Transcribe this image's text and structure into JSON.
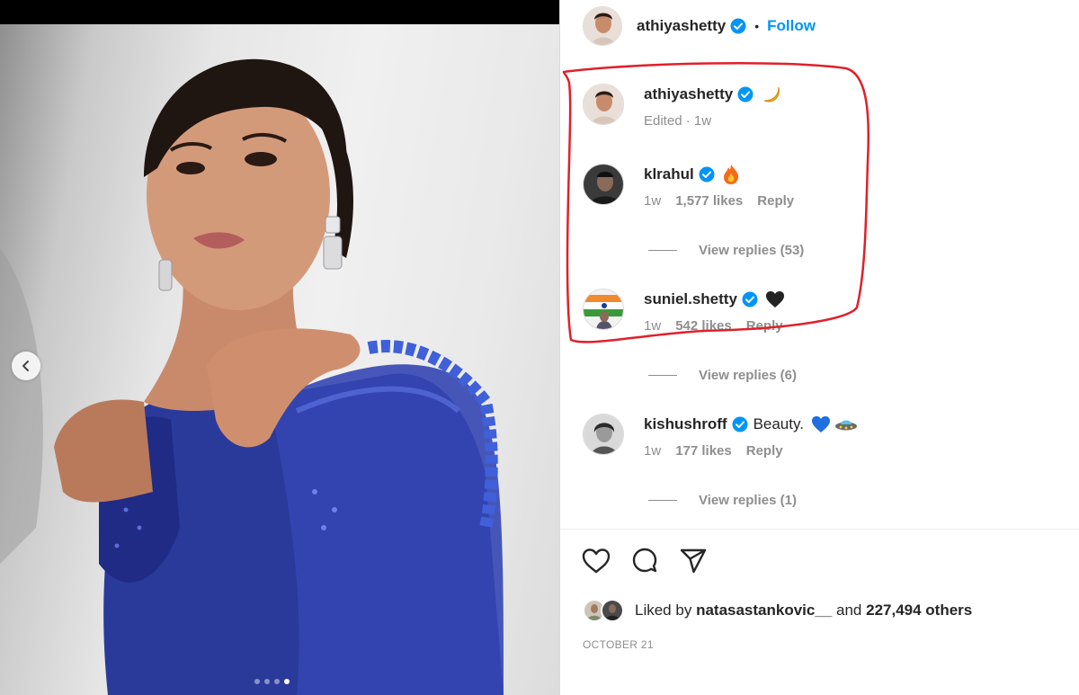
{
  "post": {
    "author": "athiyashetty",
    "follow_label": "Follow",
    "separator": "•",
    "verified_icon": "verified-badge-icon"
  },
  "carousel": {
    "prev_icon": "chevron-left-icon",
    "total_slides": 4,
    "active_slide": 4
  },
  "comments": [
    {
      "username": "athiyashetty",
      "emoji": "🌙",
      "meta": "Edited · 1w"
    },
    {
      "username": "klrahul",
      "emoji": "🔥",
      "time": "1w",
      "likes": "1,577 likes",
      "reply_label": "Reply",
      "view_replies": "View replies (53)"
    },
    {
      "username": "suniel.shetty",
      "emoji": "🖤",
      "time": "1w",
      "likes": "542 likes",
      "reply_label": "Reply",
      "view_replies": "View replies (6)"
    },
    {
      "username": "kishushroff",
      "text": "Beauty.",
      "emoji": "💙",
      "time": "1w",
      "likes": "177 likes",
      "reply_label": "Reply",
      "view_replies": "View replies (1)"
    }
  ],
  "actions": {
    "like_icon": "heart-icon",
    "comment_icon": "comment-icon",
    "share_icon": "send-icon"
  },
  "likes": {
    "prefix": "Liked by",
    "user": "natasastankovic__",
    "joiner": "and",
    "others": "227,494 others"
  },
  "date": "OCTOBER 21",
  "colors": {
    "link": "#0095f6",
    "verified": "#0095f6",
    "secondary_text": "#8e8e8e",
    "annotation": "#e0202a",
    "saree": "#2a3a9a"
  }
}
